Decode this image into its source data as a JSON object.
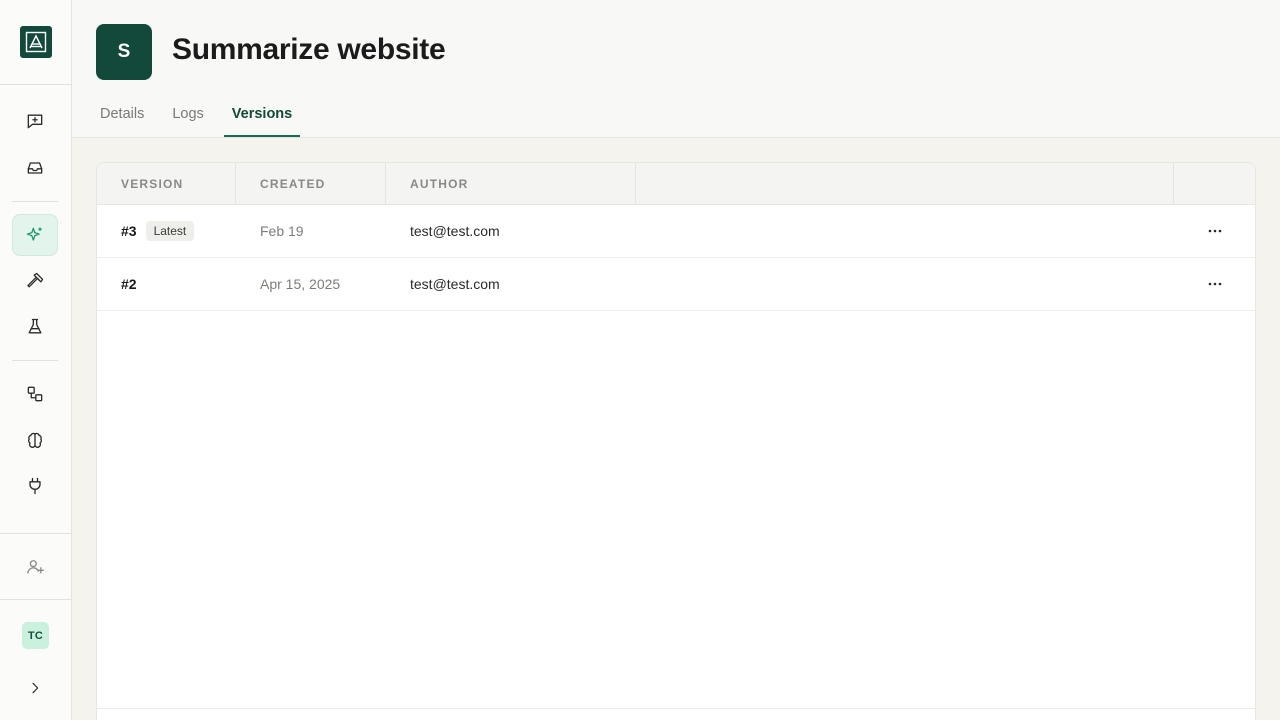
{
  "app": {
    "title": "Summarize website",
    "avatar_letter": "S",
    "accent_color": "#13493a"
  },
  "sidebar": {
    "logo_icon": "logo-icon",
    "items": [
      {
        "name": "new-chat",
        "icon": "message-plus-icon",
        "active": false
      },
      {
        "name": "inbox",
        "icon": "inbox-icon",
        "active": false
      },
      {
        "name": "agents",
        "icon": "sparkles-icon",
        "active": true
      },
      {
        "name": "tools",
        "icon": "hammer-icon",
        "active": false
      },
      {
        "name": "evals",
        "icon": "flask-icon",
        "active": false
      },
      {
        "name": "workflows",
        "icon": "workflow-icon",
        "active": false
      },
      {
        "name": "knowledge",
        "icon": "brain-icon",
        "active": false
      },
      {
        "name": "integrations",
        "icon": "plug-icon",
        "active": false
      }
    ],
    "invite_icon": "user-plus-icon",
    "user_initials": "TC",
    "expand_icon": "chevron-right-icon"
  },
  "tabs": [
    {
      "label": "Details",
      "active": false
    },
    {
      "label": "Logs",
      "active": false
    },
    {
      "label": "Versions",
      "active": true
    }
  ],
  "table": {
    "columns": [
      "VERSION",
      "CREATED",
      "AUTHOR",
      ""
    ],
    "rows": [
      {
        "version": "#3",
        "badge": "Latest",
        "created": "Feb 19",
        "author": "test@test.com"
      },
      {
        "version": "#2",
        "badge": "",
        "created": "Apr 15, 2025",
        "author": "test@test.com"
      }
    ]
  }
}
